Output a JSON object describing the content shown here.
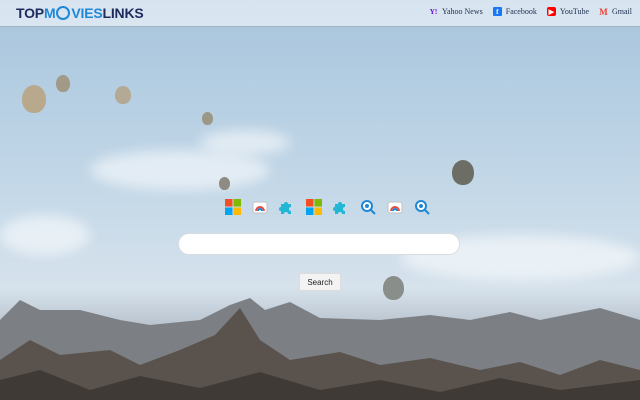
{
  "brand": {
    "part1": "TOP",
    "part2": "M",
    "part3": "VIES",
    "part4": "LINKS"
  },
  "header_links": [
    {
      "label": "Yahoo News",
      "icon": "yahoo-icon",
      "color": "#6001d2"
    },
    {
      "label": "Facebook",
      "icon": "facebook-icon",
      "color": "#1877f2"
    },
    {
      "label": "YouTube",
      "icon": "youtube-icon",
      "color": "#ff0000"
    },
    {
      "label": "Gmail",
      "icon": "gmail-icon",
      "color": "#ea4335"
    }
  ],
  "shortcuts": [
    "microsoft-icon",
    "paint-icon",
    "puzzle-icon",
    "microsoft-icon",
    "puzzle-icon",
    "film-search-icon",
    "paint-icon",
    "film-search-icon"
  ],
  "search": {
    "placeholder": "",
    "value": "",
    "button_label": "Search"
  }
}
